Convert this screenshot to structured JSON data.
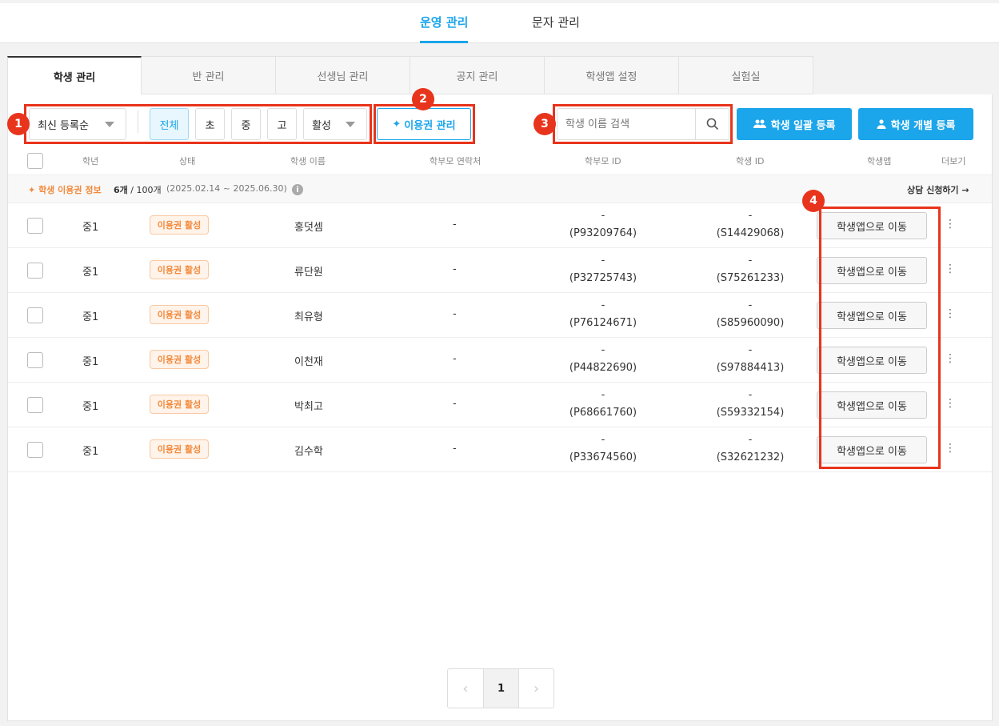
{
  "top_tabs": [
    {
      "label": "운영 관리",
      "active": true
    },
    {
      "label": "문자 관리",
      "active": false
    }
  ],
  "sub_tabs": [
    "학생 관리",
    "반 관리",
    "선생님 관리",
    "공지 관리",
    "학생앱 설정",
    "실험실"
  ],
  "toolbar": {
    "sort": "최신 등록순",
    "levels": [
      "전체",
      "초",
      "중",
      "고"
    ],
    "status_filter": "활성",
    "voucher_button": "이용권 관리",
    "search_placeholder": "학생 이름 검색",
    "bulk_register": "학생 일괄 등록",
    "single_register": "학생 개별 등록"
  },
  "annotations": [
    "1",
    "2",
    "3",
    "4"
  ],
  "columns": [
    "학년",
    "상태",
    "학생 이름",
    "학부모 연락처",
    "학부모 ID",
    "학생 ID",
    "학생앱",
    "더보기"
  ],
  "voucher_info": {
    "label": "학생 이용권 정보",
    "count": "6개",
    "total": "/ 100개",
    "period": "(2025.02.14 ~ 2025.06.30)",
    "consult": "상담 신청하기 →"
  },
  "rows": [
    {
      "grade": "중1",
      "status": "이용권 활성",
      "name": "홍덧셈",
      "parent_contact": "-",
      "parent_id_top": "-",
      "parent_id": "(P93209764)",
      "student_id_top": "-",
      "student_id": "(S14429068)",
      "app_button": "학생앱으로 이동"
    },
    {
      "grade": "중1",
      "status": "이용권 활성",
      "name": "류단원",
      "parent_contact": "-",
      "parent_id_top": "-",
      "parent_id": "(P32725743)",
      "student_id_top": "-",
      "student_id": "(S75261233)",
      "app_button": "학생앱으로 이동"
    },
    {
      "grade": "중1",
      "status": "이용권 활성",
      "name": "최유형",
      "parent_contact": "-",
      "parent_id_top": "-",
      "parent_id": "(P76124671)",
      "student_id_top": "-",
      "student_id": "(S85960090)",
      "app_button": "학생앱으로 이동"
    },
    {
      "grade": "중1",
      "status": "이용권 활성",
      "name": "이천재",
      "parent_contact": "-",
      "parent_id_top": "-",
      "parent_id": "(P44822690)",
      "student_id_top": "-",
      "student_id": "(S97884413)",
      "app_button": "학생앱으로 이동"
    },
    {
      "grade": "중1",
      "status": "이용권 활성",
      "name": "박최고",
      "parent_contact": "-",
      "parent_id_top": "-",
      "parent_id": "(P68661760)",
      "student_id_top": "-",
      "student_id": "(S59332154)",
      "app_button": "학생앱으로 이동"
    },
    {
      "grade": "중1",
      "status": "이용권 활성",
      "name": "김수학",
      "parent_contact": "-",
      "parent_id_top": "-",
      "parent_id": "(P33674560)",
      "student_id_top": "-",
      "student_id": "(S32621232)",
      "app_button": "학생앱으로 이동"
    }
  ],
  "pagination": {
    "prev": "‹",
    "current": "1",
    "next": "›"
  }
}
